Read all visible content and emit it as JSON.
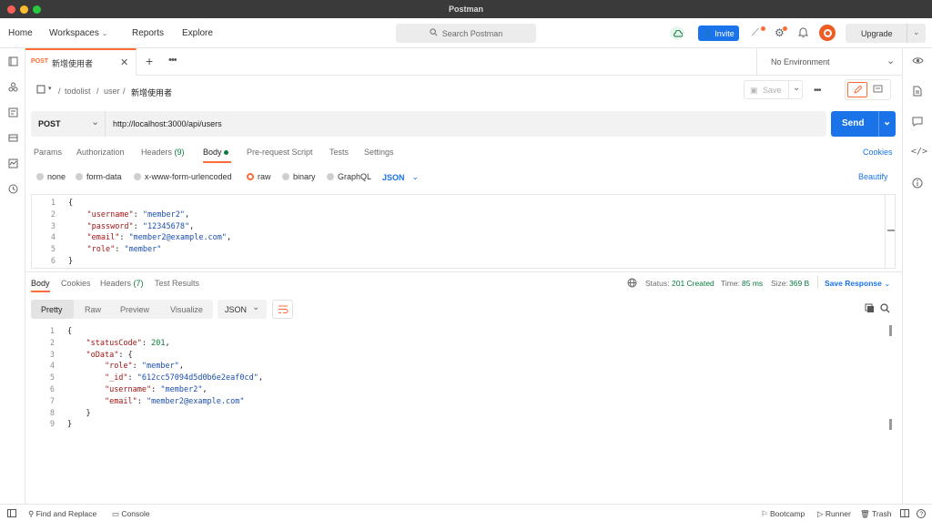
{
  "window_title": "Postman",
  "nav": {
    "home": "Home",
    "workspaces": "Workspaces",
    "reports": "Reports",
    "explore": "Explore",
    "search_placeholder": "Search Postman",
    "invite": "Invite",
    "upgrade": "Upgrade"
  },
  "tab": {
    "method": "POST",
    "name": "新增使用者"
  },
  "environment": "No Environment",
  "breadcrumb": {
    "collection": "todolist",
    "folder": "user",
    "request": "新增使用者"
  },
  "save_label": "Save",
  "request": {
    "method": "POST",
    "url": "http://localhost:3000/api/users",
    "send_label": "Send"
  },
  "request_tabs": {
    "params": "Params",
    "authorization": "Authorization",
    "headers": "Headers",
    "headers_count": "(9)",
    "body": "Body",
    "prerequest": "Pre-request Script",
    "tests": "Tests",
    "settings": "Settings",
    "cookies": "Cookies"
  },
  "body_types": {
    "none": "none",
    "form_data": "form-data",
    "urlencoded": "x-www-form-urlencoded",
    "raw": "raw",
    "binary": "binary",
    "graphql": "GraphQL",
    "json": "JSON",
    "beautify": "Beautify"
  },
  "request_body": {
    "line_numbers": [
      "1",
      "2",
      "3",
      "4",
      "5",
      "6"
    ],
    "lines": [
      {
        "text": "{"
      },
      {
        "key": "\"username\"",
        "value": "\"member2\"",
        "tail": ","
      },
      {
        "key": "\"password\"",
        "value": "\"12345678\"",
        "tail": ","
      },
      {
        "key": "\"email\"",
        "value": "\"member2@example.com\"",
        "tail": ","
      },
      {
        "key": "\"role\"",
        "value": "\"member\"",
        "tail": ""
      },
      {
        "text": "}"
      }
    ]
  },
  "response_tabs": {
    "body": "Body",
    "cookies": "Cookies",
    "headers": "Headers",
    "headers_count": "(7)",
    "test_results": "Test Results"
  },
  "response_status": {
    "status_label": "Status:",
    "status_value": "201 Created",
    "time_label": "Time:",
    "time_value": "85 ms",
    "size_label": "Size:",
    "size_value": "369 B",
    "save_response": "Save Response"
  },
  "response_views": {
    "pretty": "Pretty",
    "raw": "Raw",
    "preview": "Preview",
    "visualize": "Visualize",
    "format": "JSON"
  },
  "response_body": {
    "line_numbers": [
      "1",
      "2",
      "3",
      "4",
      "5",
      "6",
      "7",
      "8",
      "9"
    ],
    "lines": [
      {
        "indent": "",
        "text": "{"
      },
      {
        "indent": "    ",
        "key": "\"statusCode\"",
        "num": "201",
        "tail": ","
      },
      {
        "indent": "    ",
        "key": "\"oData\"",
        "text": ": {"
      },
      {
        "indent": "        ",
        "key": "\"role\"",
        "value": "\"member\"",
        "tail": ","
      },
      {
        "indent": "        ",
        "key": "\"_id\"",
        "value": "\"612cc57094d5d0b6e2eaf0cd\"",
        "tail": ","
      },
      {
        "indent": "        ",
        "key": "\"username\"",
        "value": "\"member2\"",
        "tail": ","
      },
      {
        "indent": "        ",
        "key": "\"email\"",
        "value": "\"member2@example.com\"",
        "tail": ""
      },
      {
        "indent": "    ",
        "text": "}"
      },
      {
        "indent": "",
        "text": "}"
      }
    ]
  },
  "bottom": {
    "find_replace": "Find and Replace",
    "console": "Console",
    "bootcamp": "Bootcamp",
    "runner": "Runner",
    "trash": "Trash"
  },
  "colors": {
    "accent": "#ff6c37",
    "primary": "#1a73e8",
    "status_ok": "#0b7a3e"
  }
}
